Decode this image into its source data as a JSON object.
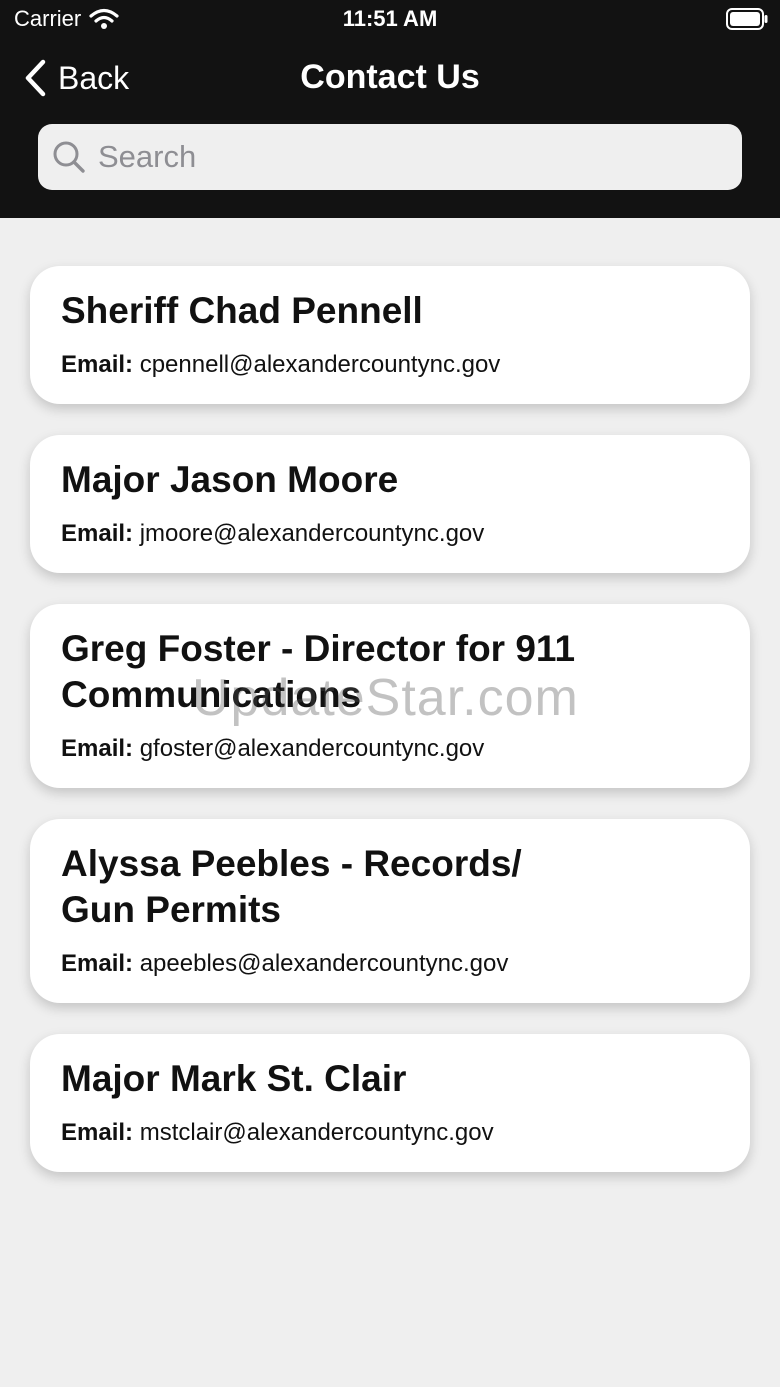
{
  "status_bar": {
    "carrier": "Carrier",
    "time": "11:51 AM"
  },
  "nav": {
    "back_label": "Back",
    "title": "Contact Us"
  },
  "search": {
    "placeholder": "Search",
    "value": ""
  },
  "contacts": [
    {
      "name_lines": [
        "Sheriff Chad Pennell"
      ],
      "email_label": "Email:",
      "email": "cpennell@alexandercountync.gov"
    },
    {
      "name_lines": [
        "Major Jason Moore"
      ],
      "email_label": "Email:",
      "email": "jmoore@alexandercountync.gov"
    },
    {
      "name_lines": [
        "Greg Foster - Director for 911",
        "Communications"
      ],
      "email_label": "Email:",
      "email": "gfoster@alexandercountync.gov"
    },
    {
      "name_lines": [
        "Alyssa Peebles - Records/",
        "Gun Permits"
      ],
      "email_label": "Email:",
      "email": "apeebles@alexandercountync.gov"
    },
    {
      "name_lines": [
        "Major Mark St. Clair"
      ],
      "email_label": "Email:",
      "email": "mstclair@alexandercountync.gov"
    }
  ],
  "watermark": "UpdateStar.com",
  "colors": {
    "header_bg": "#121212",
    "page_bg": "#efefef",
    "card_bg": "#ffffff"
  },
  "icons": [
    "wifi-icon",
    "battery-icon",
    "chevron-left-icon",
    "search-icon"
  ]
}
